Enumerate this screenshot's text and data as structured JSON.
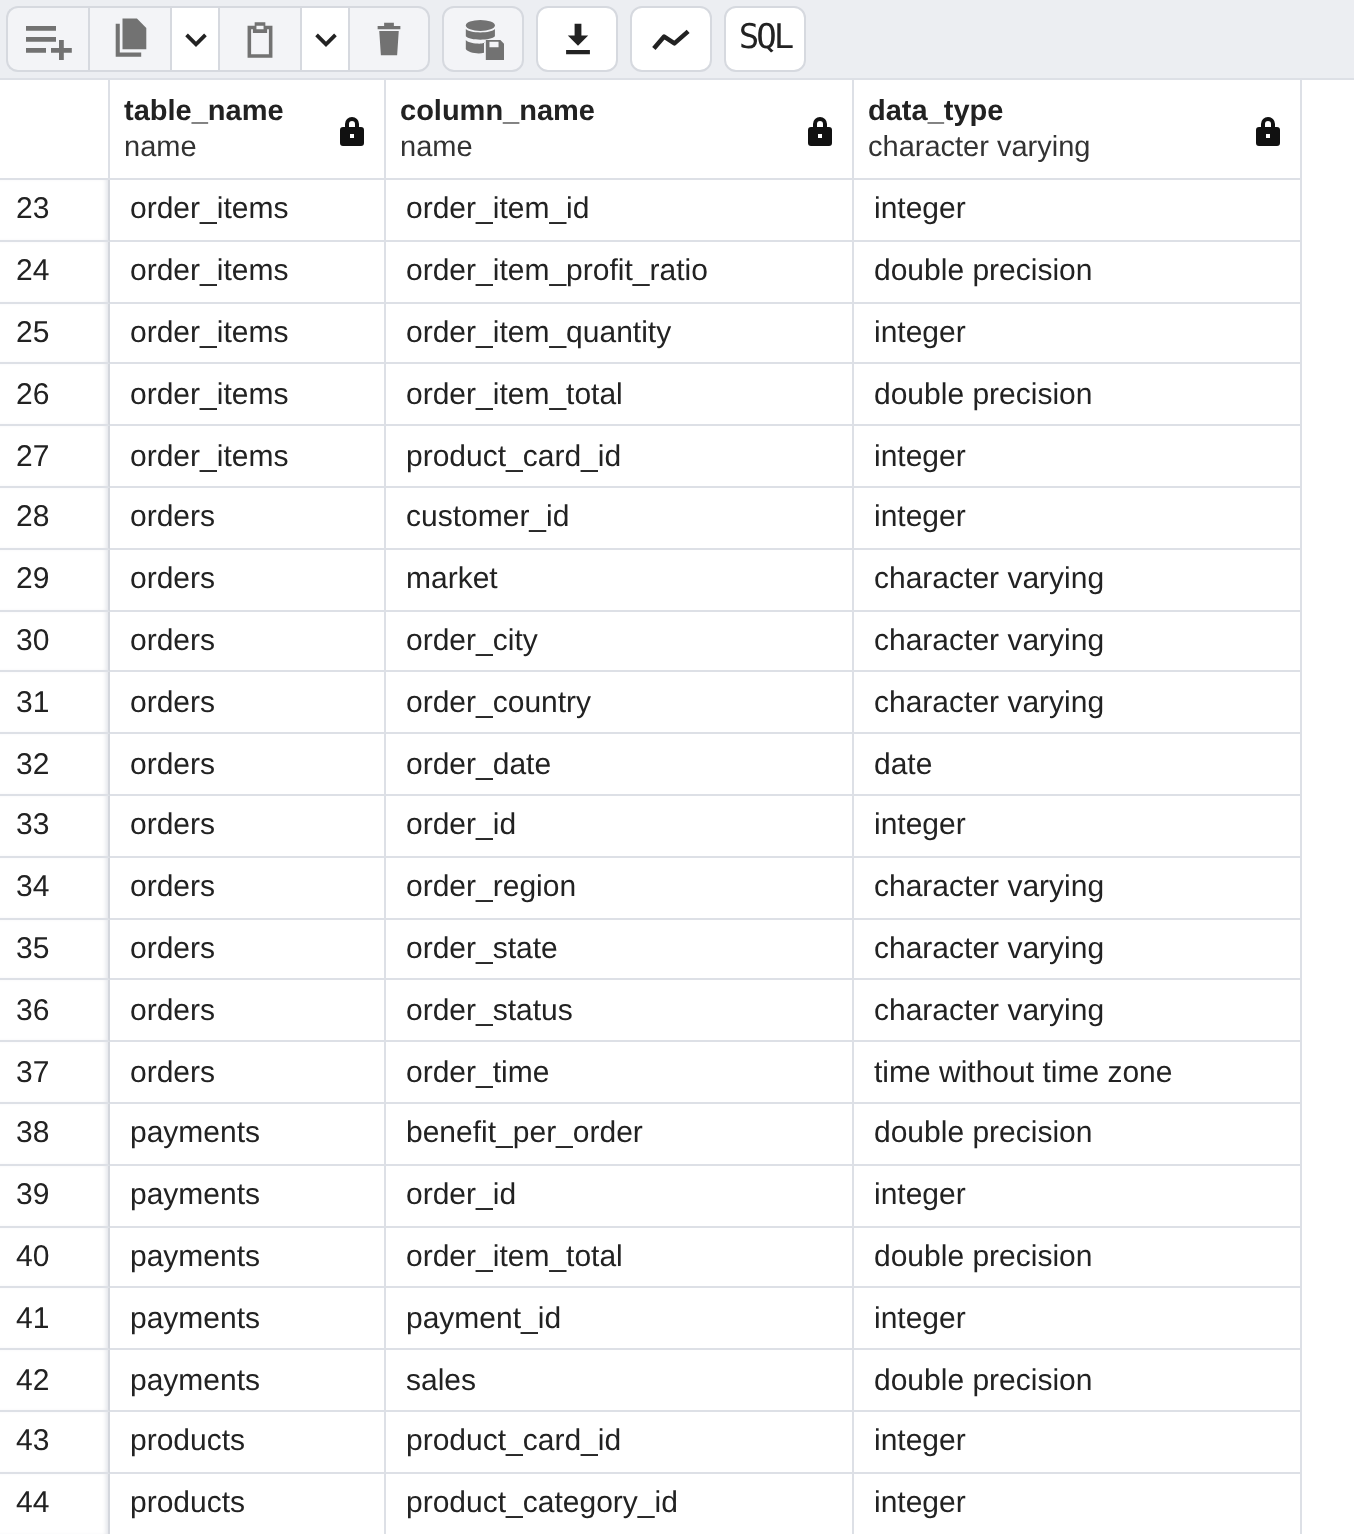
{
  "toolbar": {
    "groups": [
      {
        "buttons": [
          {
            "kind": "add-row",
            "disabled": true
          },
          {
            "kind": "copy",
            "disabled": true
          },
          {
            "kind": "dropdown",
            "disabled": false
          },
          {
            "kind": "paste",
            "disabled": true
          },
          {
            "kind": "dropdown",
            "disabled": false
          },
          {
            "kind": "delete",
            "disabled": true
          }
        ]
      },
      {
        "buttons": [
          {
            "kind": "save-data",
            "disabled": true
          }
        ]
      },
      {
        "buttons": [
          {
            "kind": "download",
            "disabled": false
          }
        ]
      },
      {
        "buttons": [
          {
            "kind": "graph",
            "disabled": false
          }
        ]
      },
      {
        "buttons": [
          {
            "kind": "sql",
            "label": "SQL",
            "disabled": false
          }
        ]
      }
    ]
  },
  "table": {
    "columns": [
      {
        "name": "table_name",
        "type": "name",
        "locked": true
      },
      {
        "name": "column_name",
        "type": "name",
        "locked": true
      },
      {
        "name": "data_type",
        "type": "character varying",
        "locked": true
      }
    ],
    "rows": [
      {
        "number": "23",
        "cells": [
          "order_items",
          "order_item_id",
          "integer"
        ]
      },
      {
        "number": "24",
        "cells": [
          "order_items",
          "order_item_profit_ratio",
          "double precision"
        ]
      },
      {
        "number": "25",
        "cells": [
          "order_items",
          "order_item_quantity",
          "integer"
        ]
      },
      {
        "number": "26",
        "cells": [
          "order_items",
          "order_item_total",
          "double precision"
        ]
      },
      {
        "number": "27",
        "cells": [
          "order_items",
          "product_card_id",
          "integer"
        ]
      },
      {
        "number": "28",
        "cells": [
          "orders",
          "customer_id",
          "integer"
        ]
      },
      {
        "number": "29",
        "cells": [
          "orders",
          "market",
          "character varying"
        ]
      },
      {
        "number": "30",
        "cells": [
          "orders",
          "order_city",
          "character varying"
        ]
      },
      {
        "number": "31",
        "cells": [
          "orders",
          "order_country",
          "character varying"
        ]
      },
      {
        "number": "32",
        "cells": [
          "orders",
          "order_date",
          "date"
        ]
      },
      {
        "number": "33",
        "cells": [
          "orders",
          "order_id",
          "integer"
        ]
      },
      {
        "number": "34",
        "cells": [
          "orders",
          "order_region",
          "character varying"
        ]
      },
      {
        "number": "35",
        "cells": [
          "orders",
          "order_state",
          "character varying"
        ]
      },
      {
        "number": "36",
        "cells": [
          "orders",
          "order_status",
          "character varying"
        ]
      },
      {
        "number": "37",
        "cells": [
          "orders",
          "order_time",
          "time without time zone"
        ]
      },
      {
        "number": "38",
        "cells": [
          "payments",
          "benefit_per_order",
          "double precision"
        ]
      },
      {
        "number": "39",
        "cells": [
          "payments",
          "order_id",
          "integer"
        ]
      },
      {
        "number": "40",
        "cells": [
          "payments",
          "order_item_total",
          "double precision"
        ]
      },
      {
        "number": "41",
        "cells": [
          "payments",
          "payment_id",
          "integer"
        ]
      },
      {
        "number": "42",
        "cells": [
          "payments",
          "sales",
          "double precision"
        ]
      },
      {
        "number": "43",
        "cells": [
          "products",
          "product_card_id",
          "integer"
        ]
      },
      {
        "number": "44",
        "cells": [
          "products",
          "product_category_id",
          "integer"
        ]
      }
    ]
  }
}
